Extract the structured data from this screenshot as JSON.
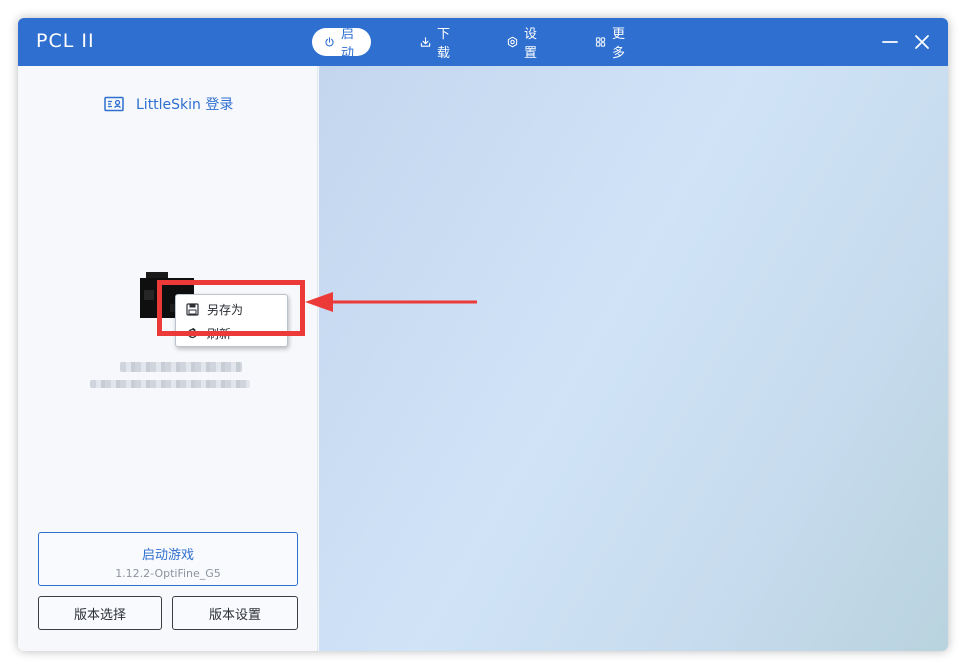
{
  "app": {
    "title": "PCL II"
  },
  "nav": {
    "tabs": [
      {
        "label": "启动",
        "icon": "power-icon",
        "active": true
      },
      {
        "label": "下载",
        "icon": "download-icon",
        "active": false
      },
      {
        "label": "设置",
        "icon": "gear-icon",
        "active": false
      },
      {
        "label": "更多",
        "icon": "grid-icon",
        "active": false
      }
    ]
  },
  "window_controls": {
    "minimize_icon": "minimize-icon",
    "close_icon": "close-icon"
  },
  "sidebar": {
    "login_label": "LittleSkin 登录",
    "login_icon": "id-card-icon",
    "context_menu": {
      "items": [
        {
          "label": "另存为",
          "icon": "save-icon"
        },
        {
          "label": "刷新",
          "icon": "refresh-icon"
        }
      ]
    },
    "launch": {
      "title": "启动游戏",
      "version": "1.12.2-OptiFine_G5"
    },
    "version_select_label": "版本选择",
    "version_settings_label": "版本设置"
  },
  "colors": {
    "accent": "#2f6fd0",
    "annotation": "#ec3a38",
    "sidebar_bg": "#f6f8fb"
  }
}
